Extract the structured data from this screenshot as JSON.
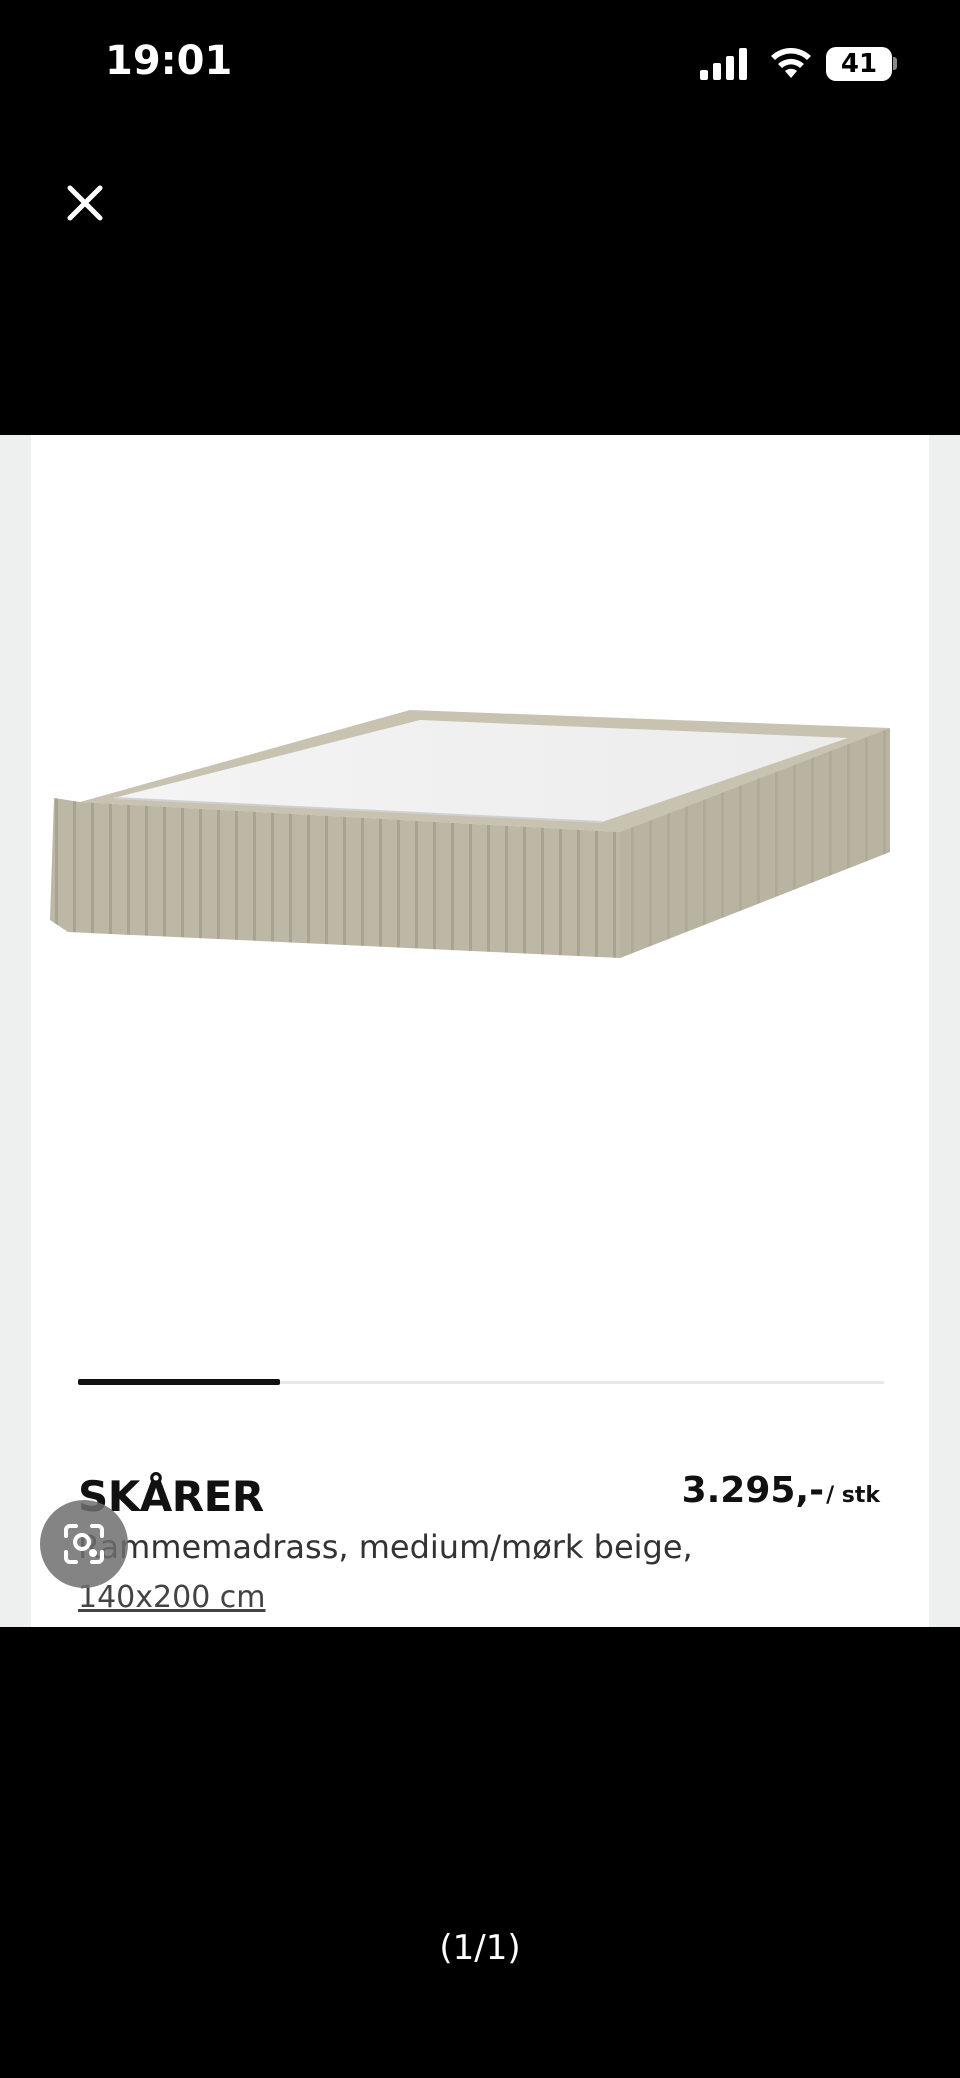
{
  "status_bar": {
    "time": "19:01",
    "battery": "41",
    "icons": [
      "signal-icon",
      "wifi-icon",
      "battery-icon"
    ]
  },
  "toolbar": {
    "close_icon": "close-icon"
  },
  "product": {
    "image_icon": "bed-base-image",
    "name": "SKÅRER",
    "price": "3.295,-",
    "price_unit": "/ stk",
    "description": "Rammemadrass, medium/mørk beige,",
    "size": "140x200 cm",
    "image_carousel_progress": 0.25
  },
  "lens_button": {
    "icon": "visual-search-icon"
  },
  "pager": {
    "text": "(1/1)"
  },
  "colors": {
    "background": "#000000",
    "card": "#ffffff",
    "text": "#111111",
    "bed_fabric": "#bdb7a6",
    "progress": "#111111"
  }
}
